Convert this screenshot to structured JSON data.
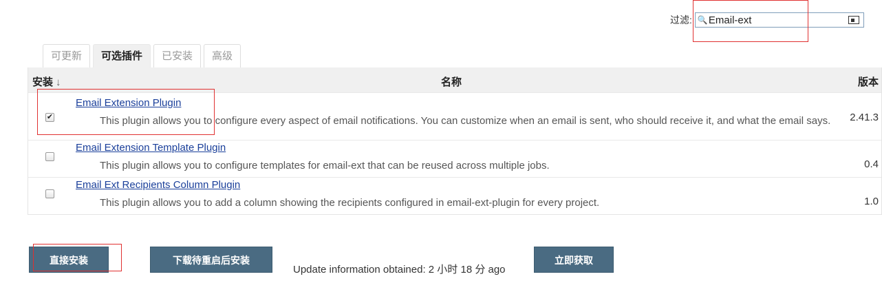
{
  "filter": {
    "label": "过滤:",
    "value": "Email-ext"
  },
  "tabs": [
    {
      "label": "可更新"
    },
    {
      "label": "可选插件"
    },
    {
      "label": "已安装"
    },
    {
      "label": "高级"
    }
  ],
  "table": {
    "headers": {
      "install": "安装",
      "sort_arrow": "↓",
      "name": "名称",
      "version": "版本"
    },
    "rows": [
      {
        "name": "Email Extension Plugin",
        "description": "This plugin allows you to configure every aspect of email notifications. You can customize when an email is sent, who should receive it, and what the email says.",
        "version": "2.41.3",
        "checked": true
      },
      {
        "name": "Email Extension Template Plugin",
        "description": "This plugin allows you to configure templates for email-ext that can be reused across multiple jobs.",
        "version": "0.4",
        "checked": false
      },
      {
        "name": "Email Ext Recipients Column Plugin",
        "description": "This plugin allows you to add a column showing the recipients configured in email-ext-plugin for every project.",
        "version": "1.0",
        "checked": false
      }
    ]
  },
  "buttons": {
    "install_now": "直接安装",
    "download_restart": "下载待重启后安装",
    "check_now": "立即获取"
  },
  "update_info": "Update information obtained: 2 小时 18 分 ago",
  "colors": {
    "highlight": "#e03030",
    "button": "#4a6b82",
    "link": "#1a3f9a"
  }
}
